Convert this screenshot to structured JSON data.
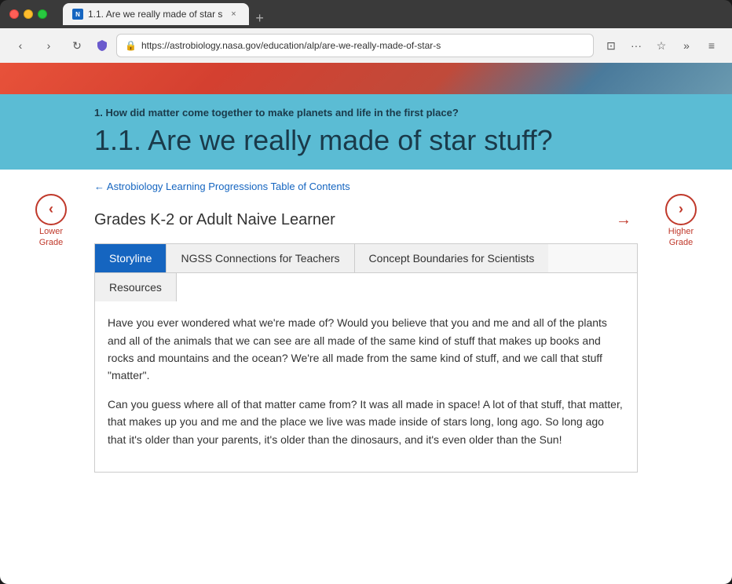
{
  "browser": {
    "tab": {
      "title": "1.1. Are we really made of star s",
      "favicon_text": "N",
      "close_label": "×"
    },
    "new_tab_label": "+",
    "nav": {
      "back_label": "‹",
      "forward_label": "›",
      "refresh_label": "↻",
      "address": "https://astrobiology.nasa.gov/education/alp/are-we-really-made-of-star-s",
      "bookmark_label": "☆",
      "menu_label": "≡",
      "shield_icon": "🛡"
    }
  },
  "page": {
    "subtitle": "1. How did matter come together to make planets and life in the first place?",
    "title": "1.1. Are we really made of star stuff?",
    "back_link": "← Astrobiology Learning Progressions Table of Contents",
    "grade_heading": "Grades K-2 or Adult Naive Learner",
    "lower_grade": {
      "label_line1": "Lower",
      "label_line2": "Grade"
    },
    "higher_grade": {
      "label_line1": "Higher",
      "label_line2": "Grade"
    },
    "arrow_symbol": "→",
    "tabs": {
      "row1": [
        {
          "label": "Storyline",
          "active": true
        },
        {
          "label": "NGSS Connections for Teachers",
          "active": false
        },
        {
          "label": "Concept Boundaries for Scientists",
          "active": false
        }
      ],
      "row2": [
        {
          "label": "Resources",
          "active": false
        }
      ]
    },
    "content": {
      "paragraph1": "Have you ever wondered what we're made of? Would you believe that you and me and all of the plants and all of the animals that we can see are all made of the same kind of stuff that makes up books and rocks and mountains and the ocean? We're all made from the same kind of stuff, and we call that stuff \"matter\".",
      "paragraph2_start": "Can you guess where all of that matter came from? It was all made in space! A lot of that stuff, that matter, that makes up you and me and the place we live was made inside of stars long, long ago. So long ago that it's older than your parents, it's older than the dinosaurs, and it's even older than the Sun!"
    }
  }
}
